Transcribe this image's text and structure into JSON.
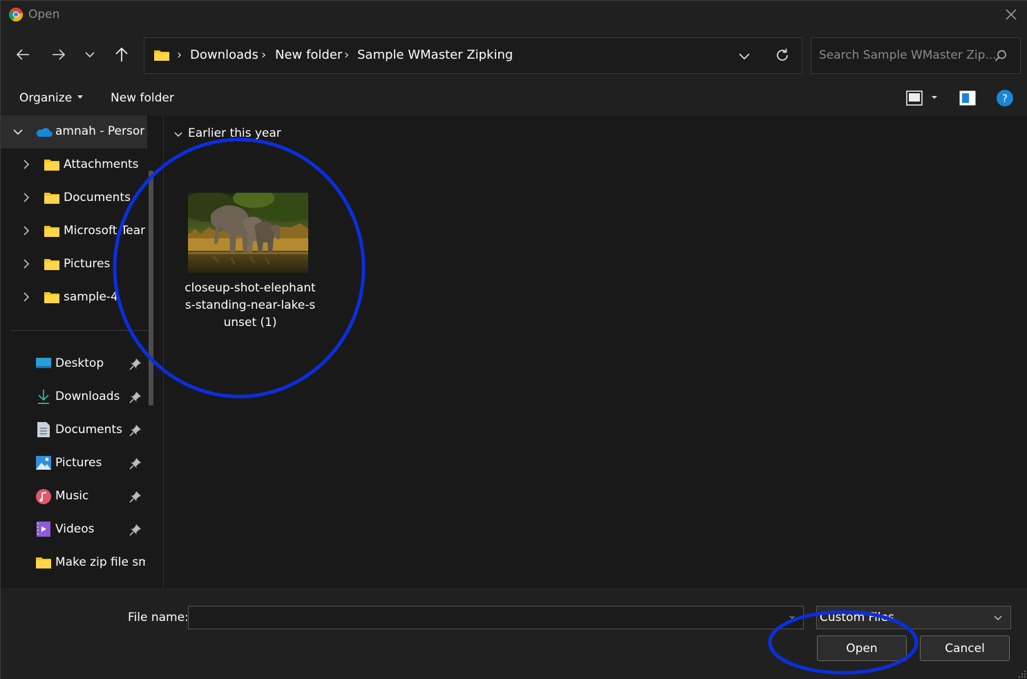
{
  "window": {
    "title": "Open",
    "app_icon": "chrome-icon"
  },
  "nav": {
    "back_icon": "back-arrow-icon",
    "forward_icon": "forward-arrow-icon",
    "recent_icon": "chevron-down-icon",
    "up_icon": "up-arrow-icon"
  },
  "address": {
    "breadcrumbs": [
      "Downloads",
      "New folder",
      "Sample WMaster Zipking"
    ],
    "separator": "›"
  },
  "search": {
    "placeholder": "Search Sample WMaster Zip..."
  },
  "toolbar": {
    "organize_label": "Organize",
    "new_folder_label": "New folder"
  },
  "sidebar": {
    "root": {
      "label": "amnah - Persona"
    },
    "folders": [
      {
        "label": "Attachments"
      },
      {
        "label": "Documents"
      },
      {
        "label": "Microsoft Tean"
      },
      {
        "label": "Pictures"
      },
      {
        "label": "sample-4"
      }
    ],
    "quick_access": [
      {
        "label": "Desktop",
        "icon": "desktop-icon",
        "pinned": true
      },
      {
        "label": "Downloads",
        "icon": "downloads-icon",
        "pinned": true
      },
      {
        "label": "Documents",
        "icon": "documents-icon",
        "pinned": true
      },
      {
        "label": "Pictures",
        "icon": "pictures-icon",
        "pinned": true
      },
      {
        "label": "Music",
        "icon": "music-icon",
        "pinned": true
      },
      {
        "label": "Videos",
        "icon": "videos-icon",
        "pinned": true
      },
      {
        "label": "Make zip file sm",
        "icon": "folder-icon",
        "pinned": false
      }
    ]
  },
  "content": {
    "group_title": "Earlier this year",
    "files": [
      {
        "name_lines": [
          "closeup-shot-elephant",
          "s-standing-near-lake-s",
          "unset (1)"
        ],
        "thumbnail": "elephants-photo"
      }
    ]
  },
  "footer": {
    "file_name_label": "File name:",
    "file_name_value": "",
    "file_type": "Custom Files",
    "open_label": "Open",
    "cancel_label": "Cancel"
  },
  "colors": {
    "background": "#191919",
    "chrome": "#202020",
    "folder": "#f5c518",
    "annotation": "#0a2fe0",
    "help": "#1a86d8"
  }
}
